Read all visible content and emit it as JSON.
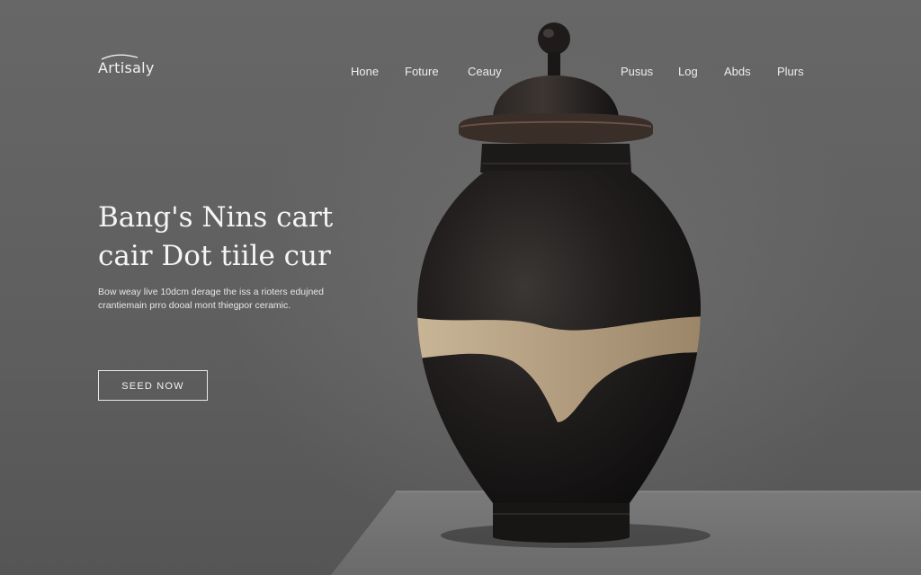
{
  "header": {
    "logo_text": "Artisaly",
    "nav": [
      "Hone",
      "Foture",
      "Ceauy",
      "Pusus",
      "Log",
      "Abds",
      "Plurs"
    ]
  },
  "hero": {
    "title_lines": [
      "Bang's Nins cart",
      "cair Dot tiile cur"
    ],
    "body_lines": [
      "Bow weay live 10dcm derage the iss a rioters edujned",
      "crantiemain prro dooal mont thiegpor ceramic."
    ],
    "cta_label": "SEED NOW"
  },
  "product": {
    "image": "black-ceramic-urn-with-lid",
    "body_color": "#1c1a19",
    "band_color": "#b9a489"
  }
}
